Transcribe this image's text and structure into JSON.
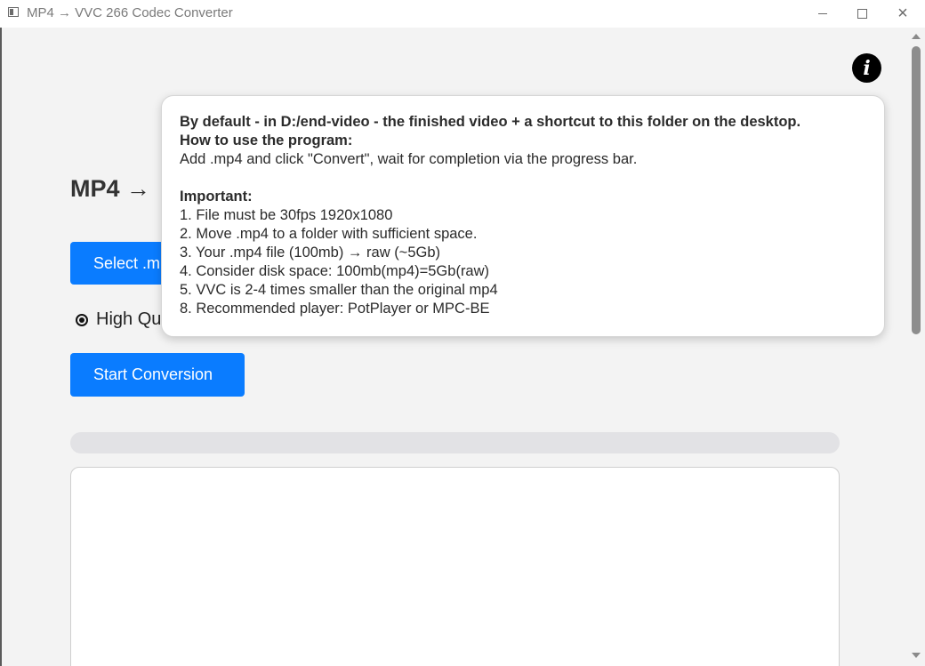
{
  "window": {
    "title": "MP4 → VVC 266 Codec Converter",
    "minimize_glyph": "minimize-icon",
    "maximize_glyph": "maximize-icon",
    "close_glyph": "×"
  },
  "info_icon": {
    "glyph": "i"
  },
  "main": {
    "heading": "MP4 →",
    "select_button": "Select .m",
    "quality_label": "High Qu",
    "start_button": "Start Conversion",
    "progress_fraction": 0
  },
  "tooltip": {
    "line1": "By default - in D:/end-video - the finished video + a shortcut to this folder on the desktop.",
    "line2": "How to use the program:",
    "line3": "Add .mp4 and click \"Convert\", wait for completion via the progress bar.",
    "important_title": "Important:",
    "items": [
      "1. File must be 30fps 1920x1080",
      "2. Move .mp4 to a folder with sufficient space.",
      "3. Your .mp4 file (100mb) → raw (~5Gb)",
      "4. Consider disk space: 100mb(mp4)=5Gb(raw)",
      "5. VVC is 2-4 times smaller than the original mp4",
      "8. Recommended player: PotPlayer or MPC-BE"
    ]
  },
  "colors": {
    "accent": "#0a7cff",
    "background": "#f3f3f3"
  }
}
